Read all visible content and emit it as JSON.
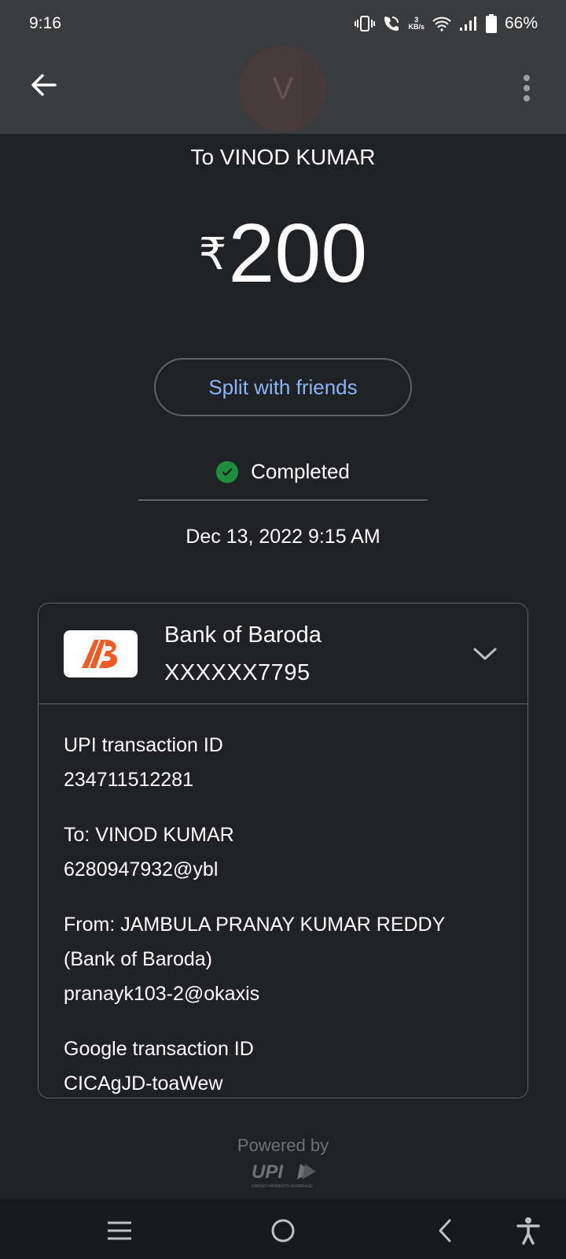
{
  "status_bar": {
    "time": "9:16",
    "net_speed_value": "3",
    "net_speed_unit": "KB/s",
    "battery": "66%"
  },
  "header": {
    "avatar_letter": "V"
  },
  "payment": {
    "to_label": "To VINOD KUMAR",
    "currency_symbol": "₹",
    "amount": "200",
    "split_button": "Split with friends",
    "status": "Completed",
    "datetime": "Dec 13, 2022 9:15 AM"
  },
  "bank_card": {
    "bank_name": "Bank of Baroda",
    "account_masked": "XXXXXX7795",
    "details": {
      "upi_txn_label": "UPI transaction ID",
      "upi_txn_value": "234711512281",
      "to_line": "To: VINOD KUMAR",
      "to_upi": "6280947932@ybl",
      "from_line1": "From: JAMBULA PRANAY KUMAR REDDY",
      "from_line2": "(Bank of Baroda)",
      "from_upi": "pranayk103-2@okaxis",
      "google_txn_label": "Google transaction ID",
      "google_txn_value": "CICAgJD-toaWew"
    }
  },
  "footer": {
    "powered_by": "Powered by",
    "upi_logo": "UPI",
    "upi_tagline": "UNIFIED PAYMENTS INTERFACE"
  },
  "colors": {
    "background": "#202124",
    "header": "#3a3b3d",
    "link_blue": "#8ab4f8",
    "success_green": "#1e8e3e",
    "bob_orange": "#f15a22"
  },
  "icons": {
    "back": "arrow-left",
    "more": "three-dots-vertical",
    "status_check": "check-circle",
    "expand": "chevron-down",
    "nav_recents": "menu-lines",
    "nav_home": "circle",
    "nav_back": "chevron-left",
    "nav_accessibility": "accessibility-person"
  }
}
